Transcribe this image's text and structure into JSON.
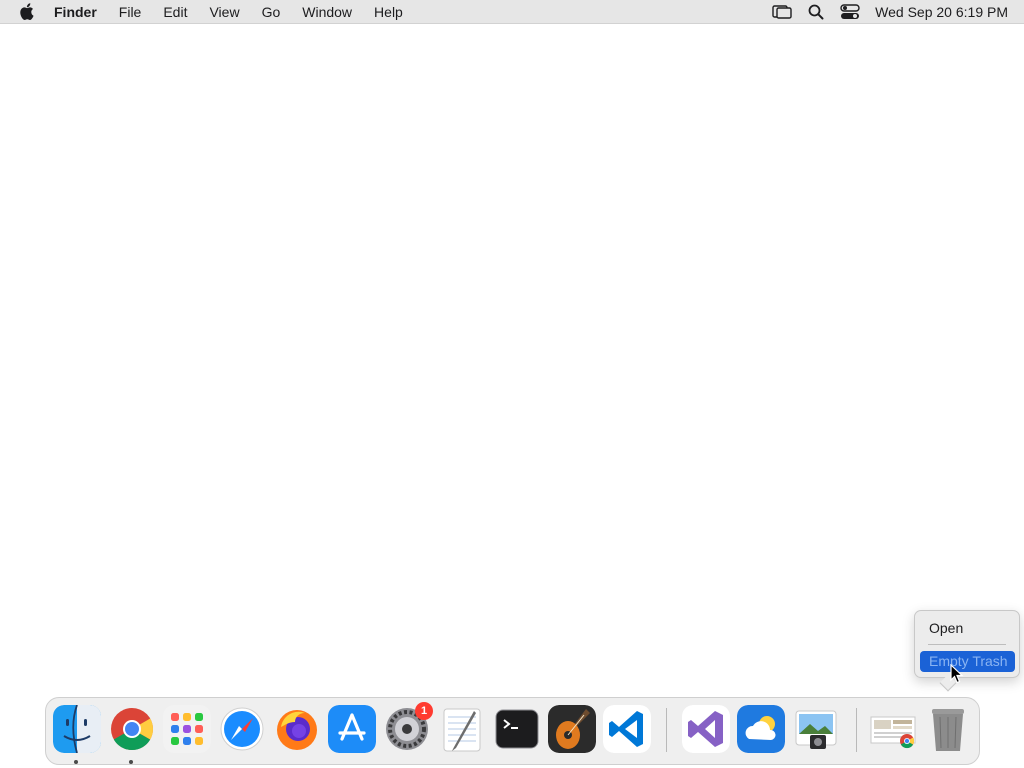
{
  "menubar": {
    "app_name": "Finder",
    "menus": [
      "File",
      "Edit",
      "View",
      "Go",
      "Window",
      "Help"
    ],
    "clock": "Wed Sep 20  6:19 PM",
    "status_icons": [
      "display-icon",
      "spotlight-search-icon",
      "control-center-icon"
    ]
  },
  "context_menu": {
    "items": [
      "Open",
      "Empty Trash"
    ],
    "highlighted": "Empty Trash"
  },
  "dock": {
    "apps": [
      {
        "name": "Finder",
        "icon": "finder-icon",
        "running": true
      },
      {
        "name": "Google Chrome",
        "icon": "chrome-icon",
        "running": true
      },
      {
        "name": "Launchpad",
        "icon": "launchpad-icon",
        "running": false
      },
      {
        "name": "Safari",
        "icon": "safari-icon",
        "running": false
      },
      {
        "name": "Firefox",
        "icon": "firefox-icon",
        "running": false
      },
      {
        "name": "App Store",
        "icon": "app-store-icon",
        "running": false
      },
      {
        "name": "System Settings",
        "icon": "system-settings-icon",
        "running": false,
        "badge": "1"
      },
      {
        "name": "TextEdit",
        "icon": "textedit-icon",
        "running": false
      },
      {
        "name": "Terminal",
        "icon": "terminal-icon",
        "running": false
      },
      {
        "name": "GarageBand",
        "icon": "garageband-icon",
        "running": false
      },
      {
        "name": "Visual Studio Code",
        "icon": "vscode-icon",
        "running": false
      },
      {
        "name": "Visual Studio",
        "icon": "visual-studio-icon",
        "running": false
      },
      {
        "name": "Weather",
        "icon": "weather-icon",
        "running": false
      },
      {
        "name": "Preview",
        "icon": "preview-icon",
        "running": false
      },
      {
        "name": "Chrome Downloads",
        "icon": "downloads-stack-icon",
        "running": false
      },
      {
        "name": "Trash",
        "icon": "trash-icon",
        "running": false
      }
    ]
  },
  "colors": {
    "menubar_bg": "#e6e6e6",
    "menu_highlight": "#1b62d6",
    "badge": "#ff3b30"
  }
}
